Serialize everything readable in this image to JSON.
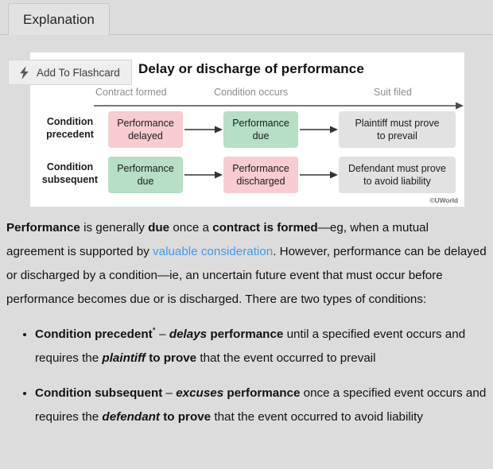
{
  "tab": {
    "label": "Explanation"
  },
  "flashcard": {
    "label": "Add To Flashcard",
    "icon": "lightning-bolt-icon"
  },
  "diagram": {
    "title": "Delay or discharge of performance",
    "copyright": "©UWorld",
    "timeline_labels": [
      "Contract formed",
      "Condition occurs",
      "Suit filed"
    ],
    "row_labels": [
      "Condition\nprecedent",
      "Condition\nsubsequent"
    ],
    "row_label_lines": [
      [
        "Condition",
        "precedent"
      ],
      [
        "Condition",
        "subsequent"
      ]
    ],
    "rows": [
      {
        "label": "Condition precedent",
        "cells": [
          {
            "text": "Performance delayed",
            "lines": [
              "Performance",
              "delayed"
            ],
            "color": "#f8ccd1",
            "tone": "pink"
          },
          {
            "text": "Performance due",
            "lines": [
              "Performance",
              "due"
            ],
            "color": "#b6dfc5",
            "tone": "green"
          },
          {
            "text": "Plaintiff must prove to prevail",
            "lines": [
              "Plaintiff must prove",
              "to prevail"
            ],
            "color": "#e2e2e2",
            "tone": "gray"
          }
        ]
      },
      {
        "label": "Condition subsequent",
        "cells": [
          {
            "text": "Performance due",
            "lines": [
              "Performance",
              "due"
            ],
            "color": "#b6dfc5",
            "tone": "green"
          },
          {
            "text": "Performance discharged",
            "lines": [
              "Performance",
              "discharged"
            ],
            "color": "#f8ccd1",
            "tone": "pink"
          },
          {
            "text": "Defendant must prove to avoid liability",
            "lines": [
              "Defendant must prove",
              "to avoid liability"
            ],
            "color": "#e2e2e2",
            "tone": "gray"
          }
        ]
      }
    ]
  },
  "body": {
    "paragraph": {
      "seg1_bold": "Performance",
      "seg2": " is generally ",
      "seg3_bold": "due",
      "seg4": " once a ",
      "seg5_bold": "contract is formed",
      "seg6": "—eg, when a mutual agreement is supported by ",
      "link": "valuable consideration",
      "seg7": ".  However, performance can be delayed or discharged by a condition—ie, an uncertain future event that must occur before performance becomes due or is discharged.  There are two types of conditions:"
    },
    "bullets": [
      {
        "term": "Condition precedent",
        "star": "*",
        "dash": " – ",
        "verb_italic": "delays",
        "after_verb_bold": " performance",
        "mid": " until a specified event occurs and requires the ",
        "party_italic": "plaintiff",
        "prove_bold": " to prove",
        "tail": " that the event occurred to prevail"
      },
      {
        "term": "Condition subsequent",
        "star": "",
        "dash": " – ",
        "verb_italic": "excuses",
        "after_verb_bold": " performance",
        "mid": " once a specified event occurs and requires the ",
        "party_italic": "defendant",
        "prove_bold": " to prove",
        "tail": " that the event occurred to avoid liability"
      }
    ]
  },
  "colors": {
    "page_bg": "#dcdcdc",
    "card_bg": "#ffffff",
    "pink": "#f8ccd1",
    "green": "#b6dfc5",
    "gray_box": "#e2e2e2",
    "link": "#3d9bf0",
    "muted_text": "#8d8d8d"
  }
}
